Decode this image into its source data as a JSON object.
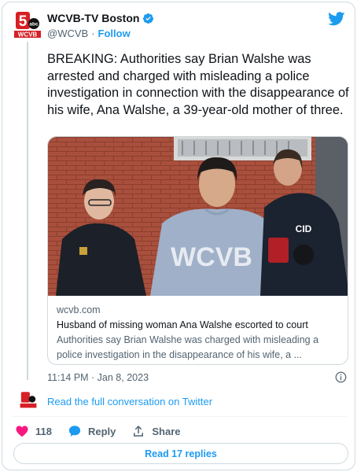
{
  "account": {
    "display_name": "WCVB-TV Boston",
    "handle": "@WCVB",
    "separator": "·",
    "follow_label": "Follow",
    "logo_text": "WCVB",
    "logo_channel": "5",
    "logo_network": "abc"
  },
  "tweet": {
    "text": "BREAKING: Authorities say Brian Walshe was arrested and charged with misleading a police investigation in connection with the disappearance of his wife, Ana Walshe, a 39-year-old mother of three.",
    "timestamp": "11:14 PM · Jan 8, 2023"
  },
  "link_card": {
    "domain": "wcvb.com",
    "title": "Husband of missing woman Ana Walshe escorted to court",
    "description": "Authorities say Brian Walshe was charged with misleading a police investigation in the disappearance of his wife, a ...",
    "photo_watermark": "WCVB",
    "photo_badge": "CID"
  },
  "conversation": {
    "label": "Read the full conversation on Twitter"
  },
  "actions": {
    "like_count": "118",
    "reply_label": "Reply",
    "share_label": "Share"
  },
  "replies_button": {
    "label": "Read 17 replies"
  },
  "colors": {
    "accent": "#1d9bf0",
    "like": "#f91880",
    "logo_red": "#d71f26",
    "text_secondary": "#536471"
  }
}
